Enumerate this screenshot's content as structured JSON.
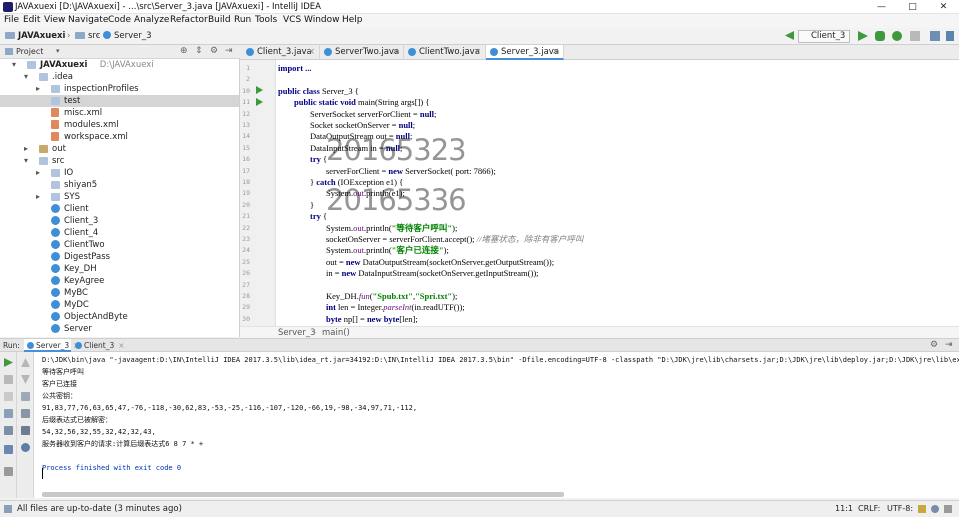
{
  "window": {
    "title": "JAVAxuexi [D:\\JAVAxuexi] - ...\\src\\Server_3.java [JAVAxuexi] - IntelliJ IDEA",
    "controls": [
      "—",
      "□",
      "✕"
    ]
  },
  "menu": [
    "File",
    "Edit",
    "View",
    "Navigate",
    "Code",
    "Analyze",
    "Refactor",
    "Build",
    "Run",
    "Tools",
    "VCS",
    "Window",
    "Help"
  ],
  "breadcrumb": [
    "JAVAxuexi",
    "src",
    "Server_3"
  ],
  "run_config": "Client_3",
  "project_panel": {
    "label": "Project"
  },
  "tree": [
    {
      "label": "JAVAxuexi",
      "extra": "D:\\JAVAxuexi",
      "depth": 0,
      "arrow": "▾",
      "icon": "folder"
    },
    {
      "label": ".idea",
      "depth": 1,
      "arrow": "▾",
      "icon": "folder"
    },
    {
      "label": "inspectionProfiles",
      "depth": 2,
      "arrow": "▸",
      "icon": "folder"
    },
    {
      "label": "test",
      "depth": 2,
      "arrow": "",
      "icon": "folder",
      "selected": true
    },
    {
      "label": "misc.xml",
      "depth": 2,
      "arrow": "",
      "icon": "xml"
    },
    {
      "label": "modules.xml",
      "depth": 2,
      "arrow": "",
      "icon": "xml"
    },
    {
      "label": "workspace.xml",
      "depth": 2,
      "arrow": "",
      "icon": "xml"
    },
    {
      "label": "out",
      "depth": 1,
      "arrow": "▸",
      "icon": "folder-y"
    },
    {
      "label": "src",
      "depth": 1,
      "arrow": "▾",
      "icon": "folder"
    },
    {
      "label": "IO",
      "depth": 2,
      "arrow": "▸",
      "icon": "folder"
    },
    {
      "label": "shiyan5",
      "depth": 2,
      "arrow": "",
      "icon": "folder"
    },
    {
      "label": "SYS",
      "depth": 2,
      "arrow": "▸",
      "icon": "folder"
    },
    {
      "label": "Client",
      "depth": 2,
      "arrow": "",
      "icon": "class"
    },
    {
      "label": "Client_3",
      "depth": 2,
      "arrow": "",
      "icon": "class"
    },
    {
      "label": "Client_4",
      "depth": 2,
      "arrow": "",
      "icon": "class"
    },
    {
      "label": "ClientTwo",
      "depth": 2,
      "arrow": "",
      "icon": "class"
    },
    {
      "label": "DigestPass",
      "depth": 2,
      "arrow": "",
      "icon": "class"
    },
    {
      "label": "Key_DH",
      "depth": 2,
      "arrow": "",
      "icon": "class"
    },
    {
      "label": "KeyAgree",
      "depth": 2,
      "arrow": "",
      "icon": "class"
    },
    {
      "label": "MyBC",
      "depth": 2,
      "arrow": "",
      "icon": "class"
    },
    {
      "label": "MyDC",
      "depth": 2,
      "arrow": "",
      "icon": "class"
    },
    {
      "label": "ObjectAndByte",
      "depth": 2,
      "arrow": "",
      "icon": "class"
    },
    {
      "label": "Server",
      "depth": 2,
      "arrow": "",
      "icon": "class"
    }
  ],
  "tabs": [
    "Client_3.java",
    "ServerTwo.java",
    "ClientTwo.java",
    "Server_3.java"
  ],
  "line_numbers": [
    "1",
    "2",
    "10",
    "11",
    "12",
    "13",
    "14",
    "15",
    "16",
    "17",
    "18",
    "19",
    "20",
    "21",
    "22",
    "23",
    "24",
    "25",
    "26",
    "27",
    "28",
    "29",
    "30"
  ],
  "code": [
    {
      "ind": 0,
      "parts": [
        {
          "t": "import ...",
          "c": "kw"
        }
      ]
    },
    {
      "ind": 0,
      "parts": []
    },
    {
      "ind": 0,
      "parts": [
        {
          "t": "public class ",
          "c": "kw"
        },
        {
          "t": "Server_3 {",
          "c": ""
        }
      ]
    },
    {
      "ind": 1,
      "parts": [
        {
          "t": "public static void ",
          "c": "kw"
        },
        {
          "t": "main(String args[]) {",
          "c": ""
        }
      ]
    },
    {
      "ind": 2,
      "parts": [
        {
          "t": "ServerSocket serverForClient = ",
          "c": ""
        },
        {
          "t": "null",
          "c": "kw"
        },
        {
          "t": ";",
          "c": ""
        }
      ]
    },
    {
      "ind": 2,
      "parts": [
        {
          "t": "Socket socketOnServer = ",
          "c": ""
        },
        {
          "t": "null",
          "c": "kw"
        },
        {
          "t": ";",
          "c": ""
        }
      ]
    },
    {
      "ind": 2,
      "parts": [
        {
          "t": "DataOutputStream out = ",
          "c": ""
        },
        {
          "t": "null",
          "c": "kw"
        },
        {
          "t": ";",
          "c": ""
        }
      ]
    },
    {
      "ind": 2,
      "parts": [
        {
          "t": "DataInputStream in = ",
          "c": ""
        },
        {
          "t": "null",
          "c": "kw"
        },
        {
          "t": ";",
          "c": ""
        }
      ]
    },
    {
      "ind": 2,
      "parts": [
        {
          "t": "try ",
          "c": "kw"
        },
        {
          "t": "{",
          "c": ""
        }
      ]
    },
    {
      "ind": 3,
      "parts": [
        {
          "t": "serverForClient = ",
          "c": ""
        },
        {
          "t": "new ",
          "c": "kw"
        },
        {
          "t": "ServerSocket( port: 7866);",
          "c": ""
        }
      ]
    },
    {
      "ind": 2,
      "parts": [
        {
          "t": "} ",
          "c": ""
        },
        {
          "t": "catch ",
          "c": "kw"
        },
        {
          "t": "(IOException e1) {",
          "c": ""
        }
      ]
    },
    {
      "ind": 3,
      "parts": [
        {
          "t": "System.",
          "c": ""
        },
        {
          "t": "out",
          "c": "fld"
        },
        {
          "t": ".println(e1);",
          "c": ""
        }
      ]
    },
    {
      "ind": 2,
      "parts": [
        {
          "t": "}",
          "c": ""
        }
      ]
    },
    {
      "ind": 2,
      "parts": [
        {
          "t": "try ",
          "c": "kw"
        },
        {
          "t": "{",
          "c": ""
        }
      ]
    },
    {
      "ind": 3,
      "parts": [
        {
          "t": "System.",
          "c": ""
        },
        {
          "t": "out",
          "c": "fld"
        },
        {
          "t": ".println(",
          "c": ""
        },
        {
          "t": "\"等待客户呼叫\"",
          "c": "str"
        },
        {
          "t": ");",
          "c": ""
        }
      ]
    },
    {
      "ind": 3,
      "parts": [
        {
          "t": "socketOnServer = serverForClient.accept(); ",
          "c": ""
        },
        {
          "t": "//堵塞状态，除非有客户呼叫",
          "c": "cm"
        }
      ]
    },
    {
      "ind": 3,
      "parts": [
        {
          "t": "System.",
          "c": ""
        },
        {
          "t": "out",
          "c": "fld"
        },
        {
          "t": ".println(",
          "c": ""
        },
        {
          "t": "\"客户已连接\"",
          "c": "str"
        },
        {
          "t": ");",
          "c": ""
        }
      ]
    },
    {
      "ind": 3,
      "parts": [
        {
          "t": "out = ",
          "c": ""
        },
        {
          "t": "new ",
          "c": "kw"
        },
        {
          "t": "DataOutputStream(socketOnServer.getOutputStream());",
          "c": ""
        }
      ]
    },
    {
      "ind": 3,
      "parts": [
        {
          "t": "in = ",
          "c": ""
        },
        {
          "t": "new ",
          "c": "kw"
        },
        {
          "t": "DataInputStream(socketOnServer.getInputStream());",
          "c": ""
        }
      ]
    },
    {
      "ind": 0,
      "parts": []
    },
    {
      "ind": 3,
      "parts": [
        {
          "t": "Key_DH.",
          "c": ""
        },
        {
          "t": "fun",
          "c": "st"
        },
        {
          "t": "(",
          "c": ""
        },
        {
          "t": "\"Spub.txt\"",
          "c": "str"
        },
        {
          "t": ",",
          "c": ""
        },
        {
          "t": "\"Spri.txt\"",
          "c": "str"
        },
        {
          "t": ");",
          "c": ""
        }
      ]
    },
    {
      "ind": 3,
      "parts": [
        {
          "t": "int ",
          "c": "kw"
        },
        {
          "t": "len = Integer.",
          "c": ""
        },
        {
          "t": "parseInt",
          "c": "st"
        },
        {
          "t": "(in.readUTF());",
          "c": ""
        }
      ]
    },
    {
      "ind": 3,
      "parts": [
        {
          "t": "byte ",
          "c": "kw"
        },
        {
          "t": "np[] = ",
          "c": ""
        },
        {
          "t": "new byte",
          "c": "kw"
        },
        {
          "t": "[len];",
          "c": ""
        }
      ]
    }
  ],
  "watermark": [
    "20165323",
    "20165336"
  ],
  "editor_breadcrumb": [
    "Server_3",
    "main()"
  ],
  "run_panel": {
    "label": "Run:",
    "tabs": [
      "Server_3",
      "Client_3"
    ]
  },
  "console": [
    "D:\\JDK\\bin\\java \"-javaagent:D:\\IN\\IntelliJ IDEA 2017.3.5\\lib\\idea_rt.jar=34192:D:\\IN\\IntelliJ IDEA 2017.3.5\\bin\" -Dfile.encoding=UTF-8 -classpath \"D:\\JDK\\jre\\lib\\charsets.jar;D:\\JDK\\jre\\lib\\deploy.jar;D:\\JDK\\jre\\lib\\ext\\access-br",
    "等待客户呼叫",
    "客户已连接",
    "公共密钥：",
    "91,83,77,76,63,65,47,-76,-118,-30,62,83,-53,-25,-116,-107,-120,-66,19,-98,-34,97,71,-112,",
    "后缀表达式已被解密：",
    "54,32,56,32,55,32,42,32,43,",
    "服务器收到客户的请求:计算后缀表达式6 8 7 * +",
    "",
    "Process finished with exit code 0"
  ],
  "status": {
    "message": "All files are up-to-date (3 minutes ago)",
    "position": "11:1",
    "line_sep": "CRLF",
    "encoding": "UTF-8"
  },
  "colors": {
    "accent": "#4a90d9",
    "run_green": "#3c9a3c",
    "keyword": "#000080",
    "string": "#008000"
  }
}
